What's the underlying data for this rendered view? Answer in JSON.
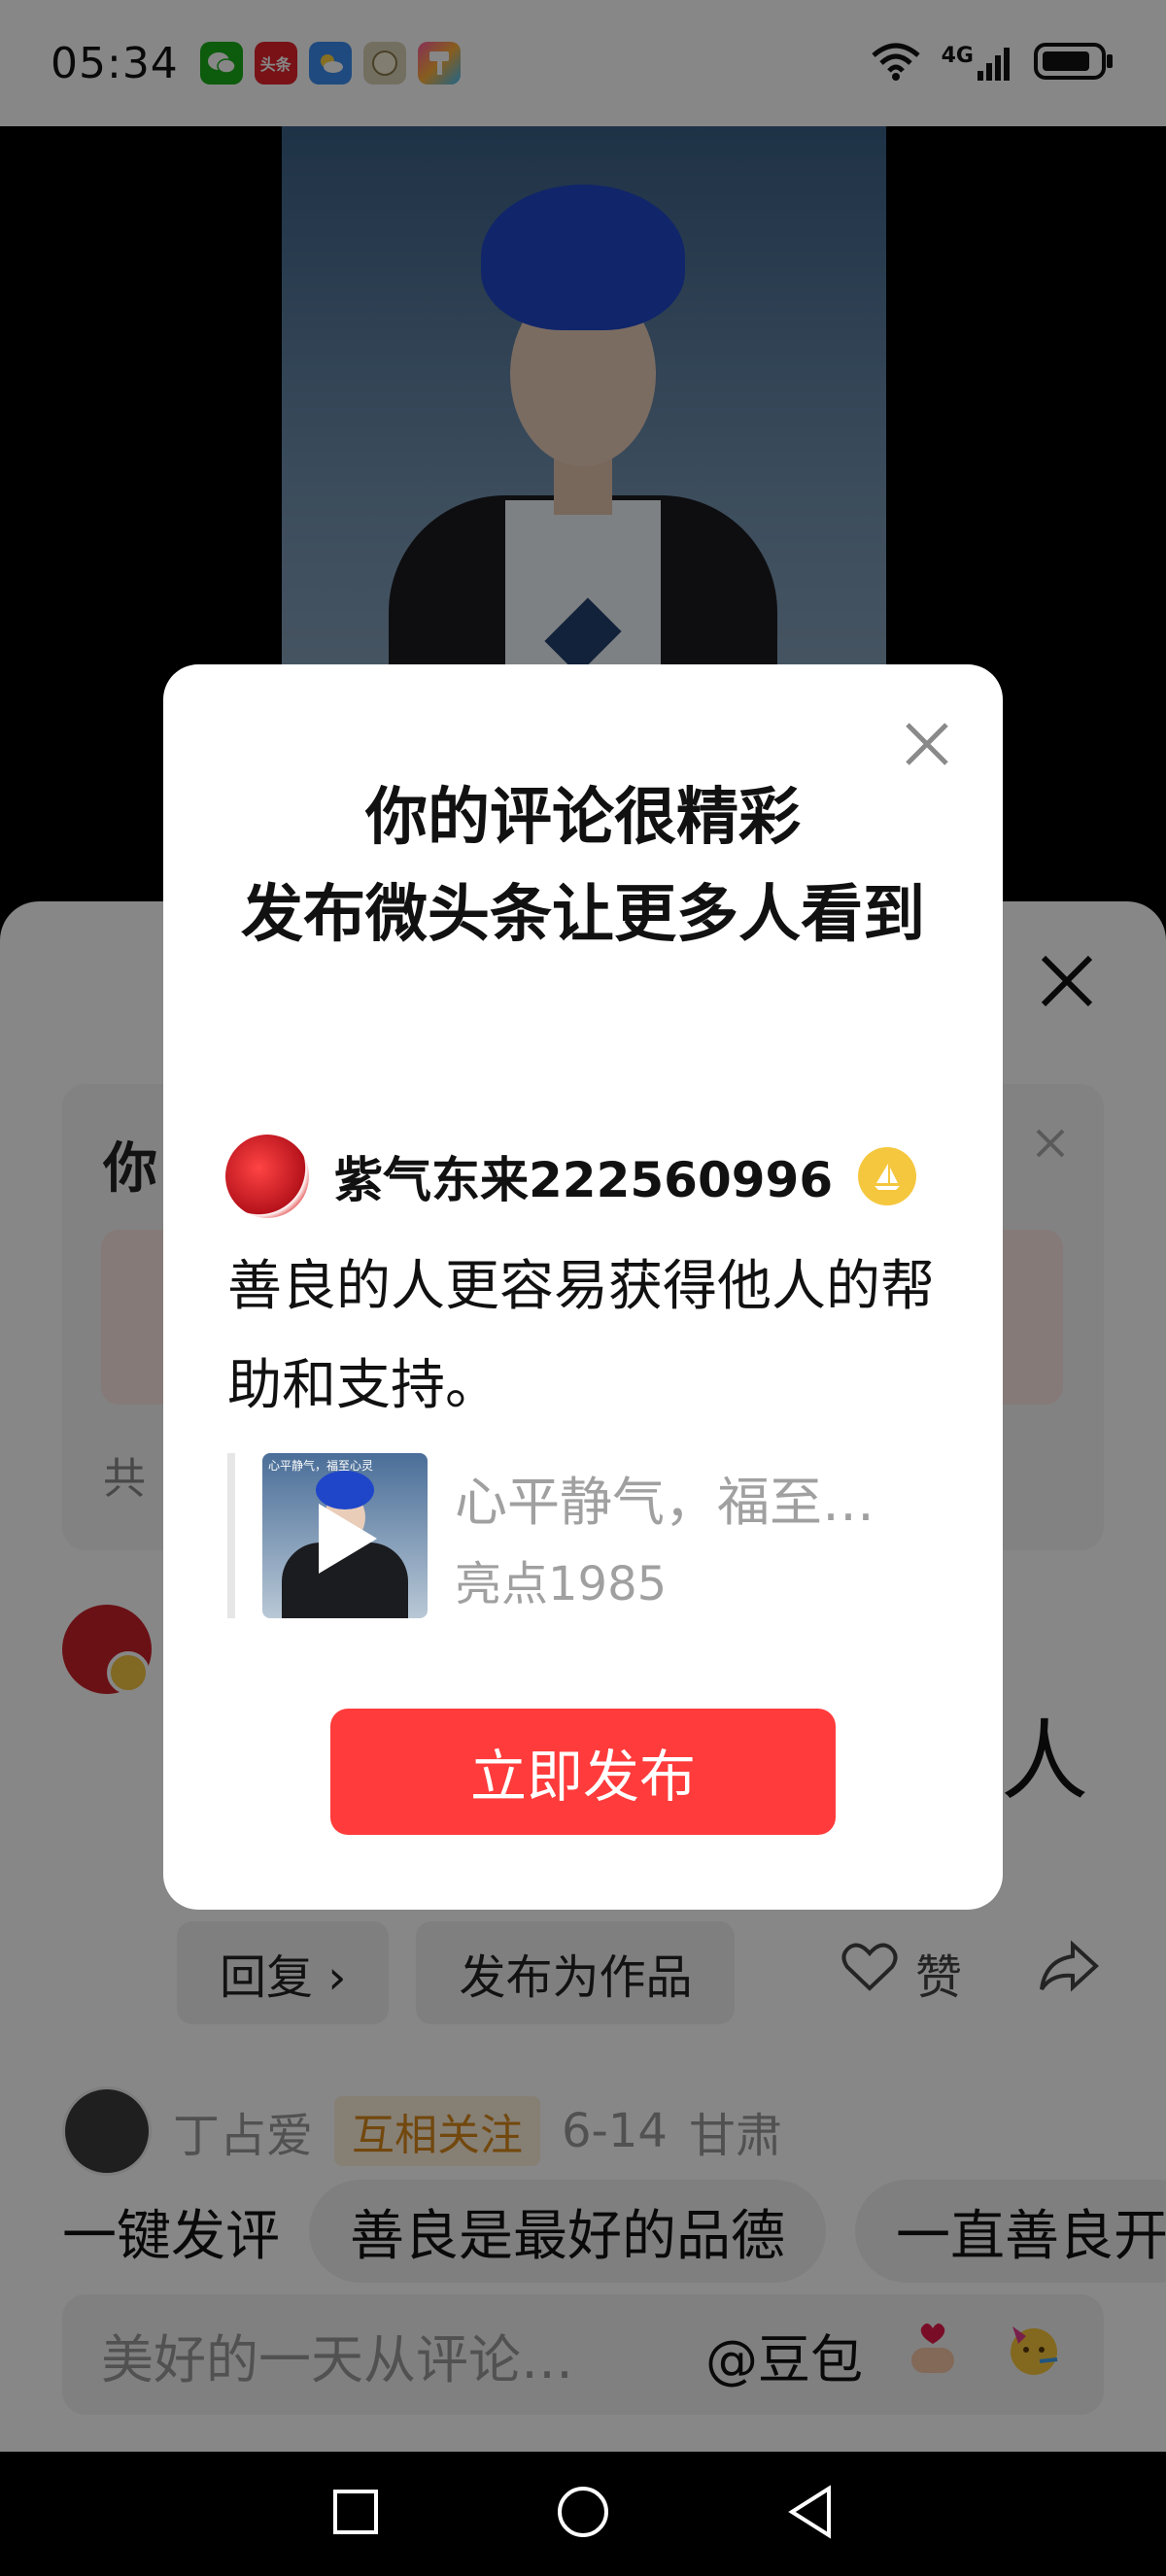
{
  "status_bar": {
    "time": "05:34",
    "notification_icons": [
      "wechat-icon",
      "toutiao-icon",
      "weather-icon",
      "app-icon",
      "paint-icon"
    ],
    "toutiao_label": "头条",
    "network": "4G"
  },
  "comment_sheet": {
    "card_title": "你",
    "card_footer": "共",
    "big_char": "人",
    "actions": {
      "reply_label": "回复 ›",
      "publish_label": "发布为作品",
      "like_label": "赞"
    },
    "second_comment": {
      "user": "丁占爱",
      "mutual_badge": "互相关注",
      "date": "6-14",
      "location": "甘肃"
    },
    "quick_replies": [
      "一键发评",
      "善良是最好的品德",
      "一直善良开"
    ],
    "input": {
      "placeholder": "美好的一天从评论…",
      "mention": "@豆包"
    }
  },
  "modal": {
    "title": "你的评论很精彩\n发布微头条让更多人看到",
    "user_name": "紫气东来222560996",
    "comment_text": "善良的人更容易获得他人的帮助和支持。",
    "quote_title": "心平静气，福至…",
    "quote_author": "亮点1985",
    "quote_thumb_caption": "心平静气，福至心灵",
    "publish_button": "立即发布"
  },
  "colors": {
    "accent": "#ff3b3b",
    "badge_gold": "#f5c73e",
    "mutual_orange": "#d8891c"
  }
}
